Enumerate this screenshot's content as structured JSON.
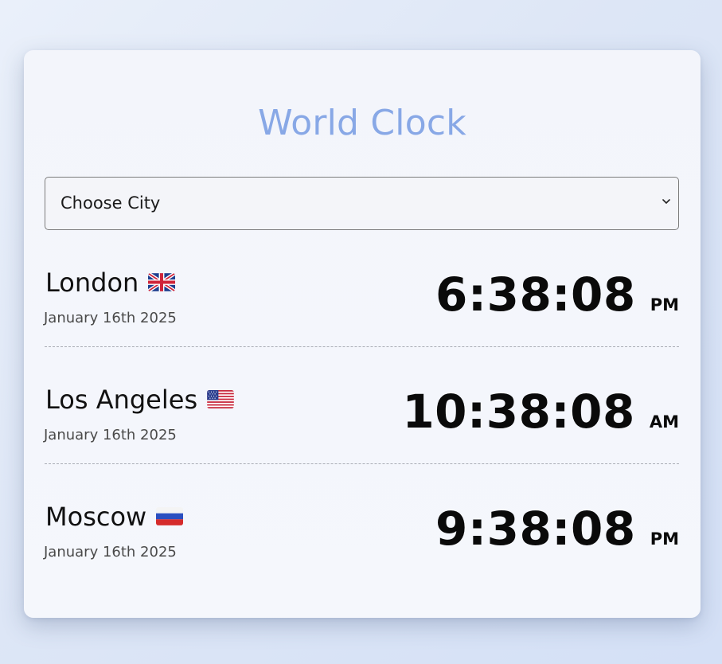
{
  "app": {
    "title": "World Clock"
  },
  "city_select": {
    "selected_label": "Choose City",
    "chevron_icon": "chevron-down-icon"
  },
  "clocks": [
    {
      "city": "London",
      "flag": "uk-flag-icon",
      "date": "January 16th 2025",
      "time": "6:38:08",
      "period": "PM"
    },
    {
      "city": "Los Angeles",
      "flag": "us-flag-icon",
      "date": "January 16th 2025",
      "time": "10:38:08",
      "period": "AM"
    },
    {
      "city": "Moscow",
      "flag": "russia-flag-icon",
      "date": "January 16th 2025",
      "time": "9:38:08",
      "period": "PM"
    }
  ],
  "colors": {
    "title": "#88a8e6",
    "card_background": "#f4f6fb",
    "page_background": "#dde6f6",
    "divider": "#a9adb5"
  }
}
